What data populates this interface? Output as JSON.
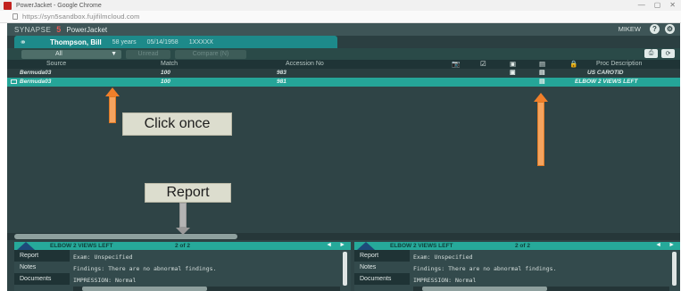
{
  "browser": {
    "title": "PowerJacket - Google Chrome",
    "url": "https://syn5sandbox.fujifilmcloud.com",
    "controls": [
      "—",
      "▢",
      "✕"
    ]
  },
  "app": {
    "brand": "SYNAPSE",
    "brand_mark": "5",
    "title": "PowerJacket",
    "user": "MIKEW",
    "help_icon": "?",
    "settings_icon": "⚙"
  },
  "patient": {
    "link_icon": "⚭",
    "name": "Thompson, Bill",
    "age": "58 years",
    "dob": "05/14/1958",
    "mrn": "1XXXXX"
  },
  "filter": {
    "selected": "All",
    "caret": "▼",
    "btn1": "Unread",
    "btn2": "Compare (N)",
    "tool1": "⎙",
    "tool2": "⟳"
  },
  "columns": {
    "source": "Source",
    "match": "Match",
    "accession": "Accession No",
    "proc_desc": "Proc Description",
    "icons": [
      "📷",
      "☑",
      "▣",
      "▤",
      "🔒"
    ]
  },
  "rows": [
    {
      "source": "Bermuda03",
      "match": "100",
      "accession": "983",
      "desc": "US CAROTID"
    },
    {
      "source": "Bermuda03",
      "match": "100",
      "accession": "981",
      "desc": "ELBOW 2 VIEWS LEFT"
    }
  ],
  "annotations": {
    "click_once": "Click once",
    "report": "Report"
  },
  "panes": [
    {
      "title": "ELBOW 2 VIEWS LEFT",
      "count": "2 of 2",
      "prev": "◄",
      "next": "►",
      "items": [
        "Report",
        "Notes",
        "Documents"
      ],
      "lines": [
        "Exam: Unspecified",
        "Findings: There are no abnormal findings.",
        "IMPRESSION: Normal"
      ]
    },
    {
      "title": "ELBOW 2 VIEWS LEFT",
      "count": "2 of 2",
      "prev": "◄",
      "next": "►",
      "items": [
        "Report",
        "Notes",
        "Documents"
      ],
      "lines": [
        "Exam: Unspecified",
        "Findings: There are no abnormal findings.",
        "IMPRESSION: Normal"
      ]
    }
  ]
}
